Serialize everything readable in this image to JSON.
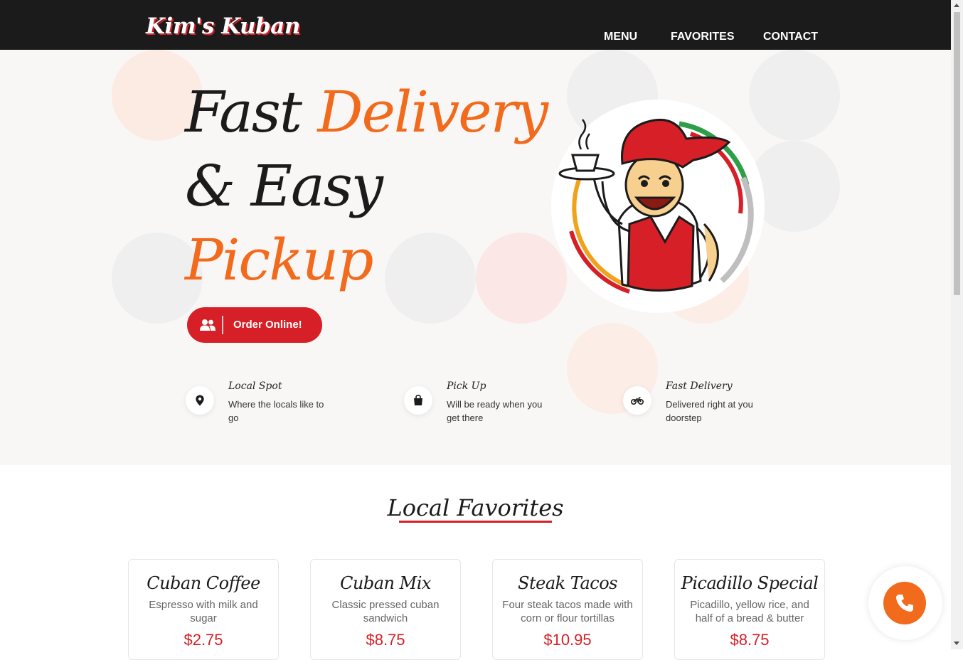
{
  "brand": {
    "name": "Kim's Kuban"
  },
  "nav": {
    "menu": "MENU",
    "favorites": "FAVORITES",
    "contact": "CONTACT"
  },
  "hero": {
    "line1_a": "Fast",
    "line1_b": "Delivery",
    "line2": "& Easy",
    "line3": "Pickup",
    "order_button": "Order Online!"
  },
  "features": [
    {
      "title": "Local Spot",
      "desc": "Where the locals like to go",
      "icon": "map-pin-icon"
    },
    {
      "title": "Pick Up",
      "desc": "Will be ready when you get there",
      "icon": "shopping-bag-icon"
    },
    {
      "title": "Fast Delivery",
      "desc": "Delivered right at you doorstep",
      "icon": "motorcycle-icon"
    }
  ],
  "favorites": {
    "title": "Local Favorites",
    "items": [
      {
        "name": "Cuban Coffee",
        "desc": "Espresso with milk and sugar",
        "price": "$2.75"
      },
      {
        "name": "Cuban Mix",
        "desc": "Classic pressed cuban sandwich",
        "price": "$8.75"
      },
      {
        "name": "Steak Tacos",
        "desc": "Four steak tacos made with corn or flour tortillas",
        "price": "$10.95"
      },
      {
        "name": "Picadillo Special",
        "desc": "Picadillo, yellow rice, and half of a bread & butter",
        "price": "$8.75"
      }
    ]
  },
  "colors": {
    "accent_red": "#d61f26",
    "accent_orange": "#f26a1b",
    "dark": "#1c1b1b"
  }
}
